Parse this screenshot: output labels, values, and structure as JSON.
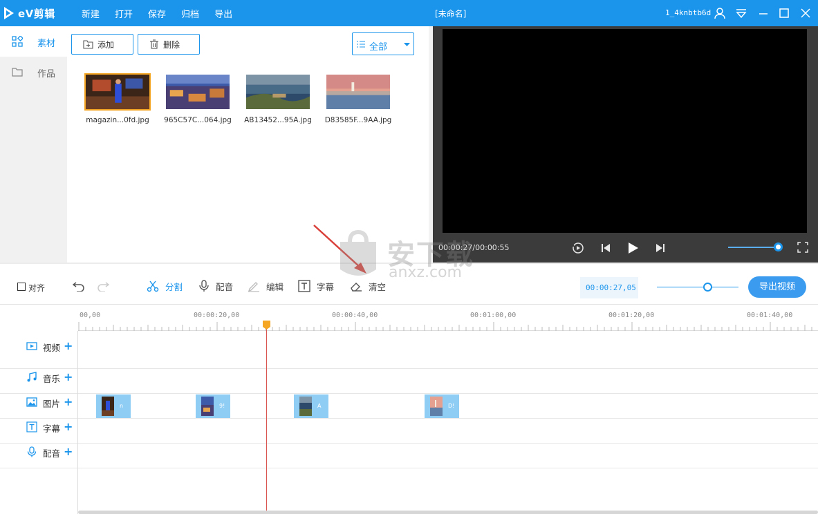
{
  "app": {
    "logo_text": "eV剪辑",
    "window_title": "[未命名]",
    "username": "1_4knbtb6d",
    "menu": [
      "新建",
      "打开",
      "保存",
      "归档",
      "导出"
    ]
  },
  "sidebar": {
    "items": [
      {
        "label": "素材",
        "active": true
      },
      {
        "label": "作品",
        "active": false
      }
    ]
  },
  "media": {
    "add_label": "添加",
    "delete_label": "删除",
    "filter_value": "全部",
    "files": [
      {
        "name": "magazin...0fd.jpg",
        "selected": true
      },
      {
        "name": "965C57C...064.jpg",
        "selected": false
      },
      {
        "name": "AB13452...95A.jpg",
        "selected": false
      },
      {
        "name": "D83585F...9AA.jpg",
        "selected": false
      }
    ]
  },
  "preview": {
    "time": "00:00:27/00:00:55",
    "volume": 0.95
  },
  "toolbar": {
    "align_label": "对齐",
    "split_label": "分割",
    "dub_label": "配音",
    "edit_label": "编辑",
    "subtitle_label": "字幕",
    "clear_label": "清空",
    "timecode": "00:00:27,05",
    "zoom": 0.62,
    "export_label": "导出视频"
  },
  "timeline": {
    "ruler_labels": [
      "00,00",
      "00:00:20,00",
      "00:00:40,00",
      "00:01:00,00",
      "00:01:20,00",
      "00:01:40,00"
    ],
    "tracks": [
      {
        "label": "视频",
        "icon": "video-icon"
      },
      {
        "label": "音乐",
        "icon": "music-icon"
      },
      {
        "label": "图片",
        "icon": "image-icon"
      },
      {
        "label": "字幕",
        "icon": "text-icon"
      },
      {
        "label": "配音",
        "icon": "mic-icon"
      }
    ],
    "clips": [
      {
        "tag": "n"
      },
      {
        "tag": "9!"
      },
      {
        "tag": "A"
      },
      {
        "tag": "D!"
      }
    ]
  },
  "watermark": {
    "text": "安下载",
    "sub": "anxz.com"
  },
  "colors": {
    "accent": "#1b95ec",
    "playhead": "#f5a623",
    "clip": "#8fcdf5"
  }
}
